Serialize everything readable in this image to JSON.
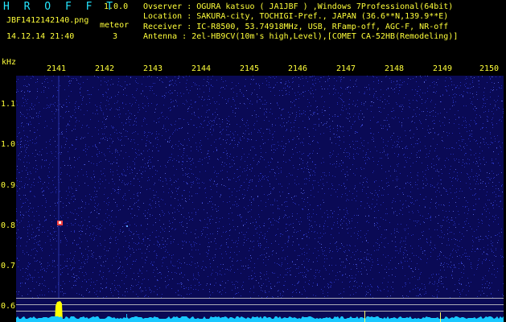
{
  "header": {
    "app_name": "H R O F F T",
    "version": "1.0.0",
    "file_name": "JBF1412142140.png",
    "meteor_label": "meteor",
    "meteor_count": "3",
    "timestamp": "14.12.14 21:40"
  },
  "info": [
    {
      "label": "Ovserver",
      "value": "OGURA katsuo ( JA1JBF ) ,Windows 7Professional(64bit)"
    },
    {
      "label": "Location",
      "value": "SAKURA-city, TOCHIGI-Pref., JAPAN (36.6**N,139.9**E)"
    },
    {
      "label": "Receiver",
      "value": "IC-R8500, 53.74918MHz, USB, RFamp-off, AGC-F, NR-off"
    },
    {
      "label": "Antenna ",
      "value": "2el-HB9CV(10m's high,Level),[COMET CA-52HB(Remodeling)]"
    }
  ],
  "spectrogram": {
    "y_unit": "kHz",
    "x_ticks": [
      "2141",
      "2142",
      "2143",
      "2144",
      "2145",
      "2146",
      "2147",
      "2148",
      "2149",
      "2150"
    ],
    "y_ticks": [
      "1.1",
      "1.0",
      "0.9",
      "0.8",
      "0.7",
      "0.6"
    ],
    "colors": {
      "background": "#0a0a55",
      "noise": "#3a4cff",
      "echo": "#ffff00",
      "baseline": "#19c8ff",
      "text": "#ffff3a",
      "title": "#25e6ff"
    }
  }
}
